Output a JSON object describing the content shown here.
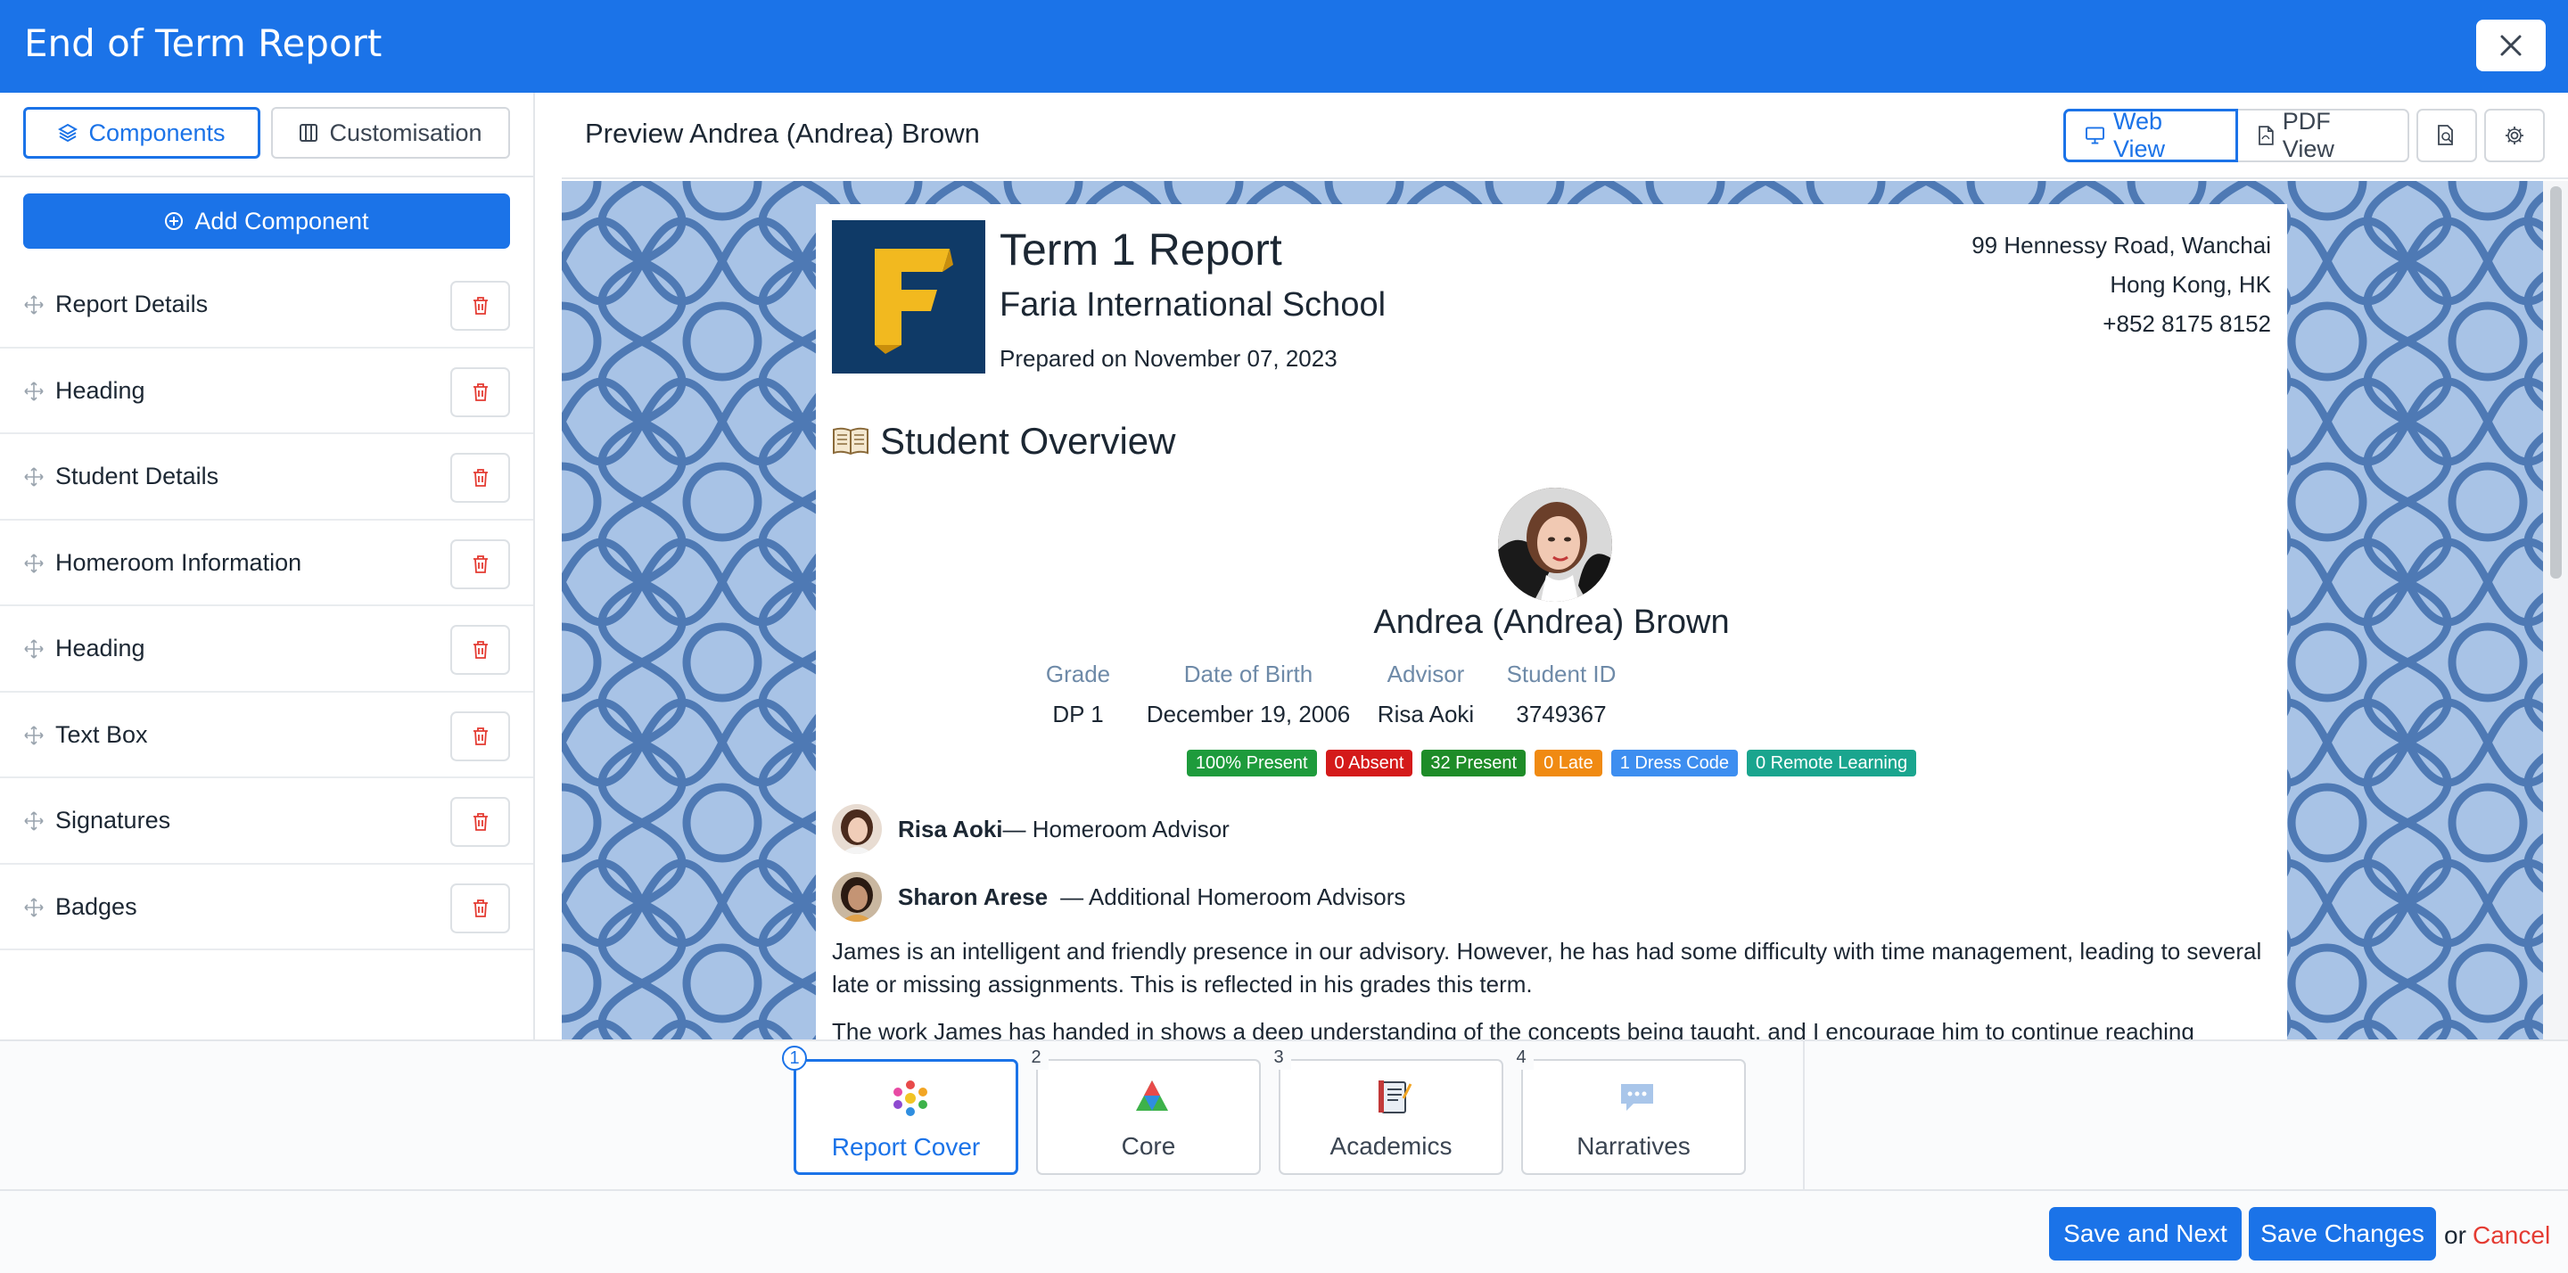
{
  "window": {
    "title": "End of Term Report",
    "close_icon": "close-icon"
  },
  "left_panel": {
    "tabs": [
      {
        "label": "Components",
        "icon": "layers-icon"
      },
      {
        "label": "Customisation",
        "icon": "columns-icon"
      }
    ],
    "add_button": "Add Component",
    "components": [
      {
        "label": "Report Details"
      },
      {
        "label": "Heading"
      },
      {
        "label": "Student Details"
      },
      {
        "label": "Homeroom Information"
      },
      {
        "label": "Heading"
      },
      {
        "label": "Text Box"
      },
      {
        "label": "Signatures"
      },
      {
        "label": "Badges"
      }
    ]
  },
  "preview_header": {
    "title": "Preview Andrea (Andrea) Brown",
    "web_view": "Web View",
    "pdf_view": "PDF View"
  },
  "report": {
    "logo_letter": "F",
    "title": "Term 1 Report",
    "school": "Faria International School",
    "prepared": "Prepared on November 07, 2023",
    "address": [
      "99 Hennessy Road, Wanchai",
      "Hong Kong, HK",
      "+852 8175 8152"
    ],
    "overview_heading": "Student Overview",
    "student_name": "Andrea (Andrea) Brown",
    "details": [
      {
        "key": "Grade",
        "value": "DP 1"
      },
      {
        "key": "Date of Birth",
        "value": "December 19, 2006"
      },
      {
        "key": "Advisor",
        "value": "Risa Aoki"
      },
      {
        "key": "Student ID",
        "value": "3749367"
      }
    ],
    "badges": [
      {
        "label": "100% Present",
        "color": "#1e9b3c"
      },
      {
        "label": "0 Absent",
        "color": "#d41a1a"
      },
      {
        "label": "32 Present",
        "color": "#1e8c28"
      },
      {
        "label": "0 Late",
        "color": "#f08a12"
      },
      {
        "label": "1 Dress Code",
        "color": "#3d8ef0"
      },
      {
        "label": "0 Remote Learning",
        "color": "#1aa58e"
      }
    ],
    "advisors": [
      {
        "name": "Risa Aoki",
        "role": "— Homeroom Advisor"
      },
      {
        "name": "Sharon Arese",
        "role": "— Additional Homeroom Advisors"
      }
    ],
    "narrative_1": "James is an intelligent and friendly presence in our advisory. However, he has had some difficulty with time management, leading to several late or missing assignments. This is reflected in his grades this term.",
    "narrative_2": "The work James has handed in shows a deep understanding of the concepts being taught, and I encourage him to continue reaching"
  },
  "steps": [
    {
      "num": "1",
      "label": "Report Cover",
      "icon": "report-cover-icon"
    },
    {
      "num": "2",
      "label": "Core",
      "icon": "core-icon"
    },
    {
      "num": "3",
      "label": "Academics",
      "icon": "academics-icon"
    },
    {
      "num": "4",
      "label": "Narratives",
      "icon": "narratives-icon"
    }
  ],
  "footer": {
    "save_next": "Save and Next",
    "save_changes": "Save Changes",
    "or": "or",
    "cancel": "Cancel"
  },
  "colors": {
    "accent": "#1b73e8",
    "cancel": "#e43b32",
    "pattern_bg": "#a8c3e6",
    "pattern_line": "#4e79b4"
  }
}
